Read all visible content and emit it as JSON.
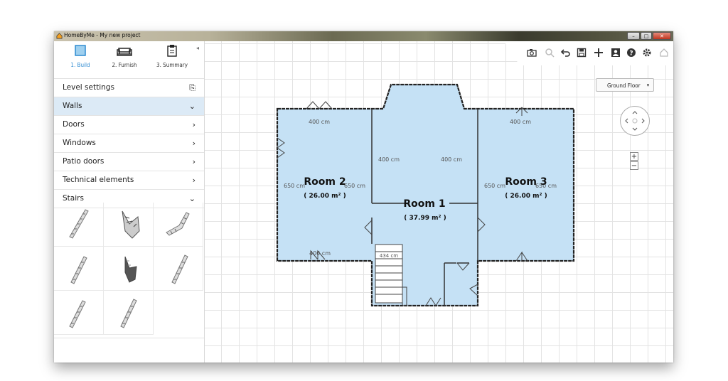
{
  "window": {
    "title": "HomeByMe - My new project",
    "min_label": "–",
    "max_label": "□",
    "close_label": "✕"
  },
  "steps": [
    {
      "label": "1. Build",
      "icon": "build-icon",
      "active": true
    },
    {
      "label": "2. Furnish",
      "icon": "sofa-icon",
      "active": false
    },
    {
      "label": "3. Summary",
      "icon": "clipboard-icon",
      "active": false
    }
  ],
  "collapse_label": "◂",
  "menu": [
    {
      "label": "Level settings",
      "arrow": "⎘"
    },
    {
      "label": "Walls",
      "arrow": "⌄"
    },
    {
      "label": "Doors",
      "arrow": "›"
    },
    {
      "label": "Windows",
      "arrow": "›"
    },
    {
      "label": "Patio doors",
      "arrow": "›"
    },
    {
      "label": "Technical elements",
      "arrow": "›"
    },
    {
      "label": "Stairs",
      "arrow": "⌄"
    }
  ],
  "toolbar": [
    "camera-icon",
    "search-icon",
    "undo-icon",
    "save-icon",
    "add-icon",
    "user-icon",
    "help-icon",
    "settings-icon",
    "home-icon"
  ],
  "floor_selector": {
    "value": "Ground Floor",
    "dropdown": "▾"
  },
  "zoom": {
    "in": "+",
    "out": "−"
  },
  "plan": {
    "room2": {
      "name": "Room 2",
      "area": "( 26.00 m² )",
      "dim_top": "400 cm",
      "dim_left": "650 cm",
      "dim_right": "650 cm",
      "dim_bottom": "400 cm"
    },
    "room1": {
      "name": "Room 1",
      "area": "( 37.99 m² )",
      "dim_left": "400 cm",
      "dim_right": "400 cm",
      "dim_stairs": "434 cm"
    },
    "room3": {
      "name": "Room 3",
      "area": "( 26.00 m² )",
      "dim_top": "400 cm",
      "dim_left": "650 cm",
      "dim_right": "650 cm"
    }
  },
  "colors": {
    "room_fill": "#c5e1f5",
    "wall": "#222222",
    "accent": "#2f8bd1",
    "highlight": "#dceaf6"
  }
}
